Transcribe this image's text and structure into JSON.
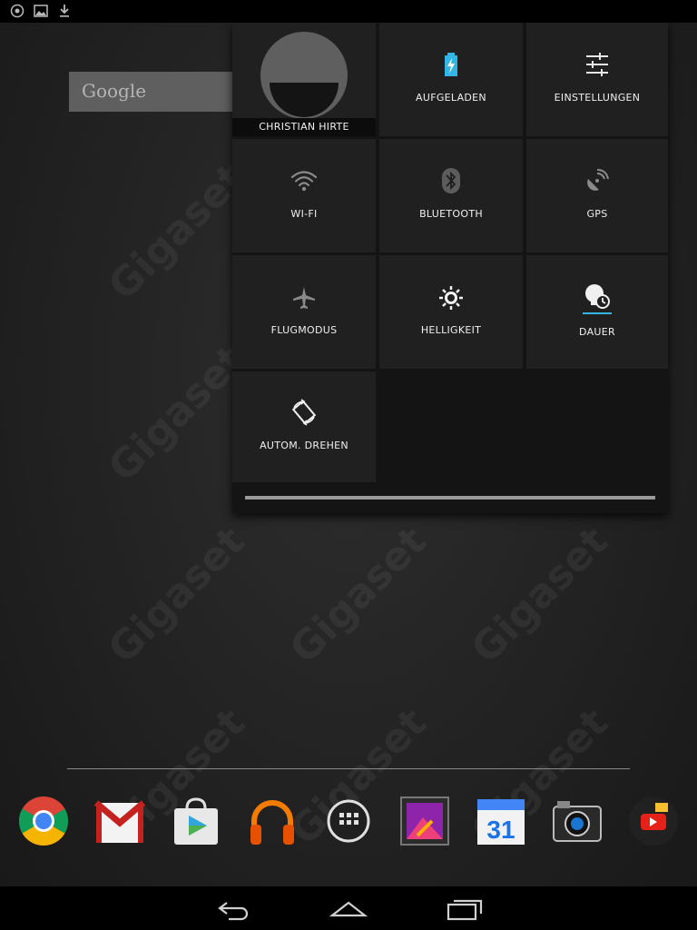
{
  "statusbar": {
    "icons": [
      "network-settings-icon",
      "gallery-icon",
      "download-icon"
    ]
  },
  "google_bar": {
    "logo_text": "Google"
  },
  "quick_settings": {
    "user": {
      "name": "CHRISTIAN HIRTE"
    },
    "tiles": [
      {
        "label": "AUFGELADEN",
        "icon": "battery-charging-icon"
      },
      {
        "label": "EINSTELLUNGEN",
        "icon": "settings-sliders-icon"
      },
      {
        "label": "WI-FI",
        "icon": "wifi-icon"
      },
      {
        "label": "BLUETOOTH",
        "icon": "bluetooth-icon"
      },
      {
        "label": "GPS",
        "icon": "gps-icon"
      },
      {
        "label": "FLUGMODUS",
        "icon": "airplane-icon"
      },
      {
        "label": "HELLIGKEIT",
        "icon": "brightness-icon"
      },
      {
        "label": "DAUER",
        "icon": "screen-timeout-icon"
      },
      {
        "label": "AUTOM. DREHEN",
        "icon": "auto-rotate-icon"
      }
    ]
  },
  "wallpaper": {
    "watermark": "Gigaset"
  },
  "dock": {
    "apps": [
      "chrome-icon",
      "gmail-icon",
      "play-store-icon",
      "play-music-icon",
      "app-drawer-icon",
      "gallery-app-icon",
      "calendar-icon",
      "camera-icon",
      "youtube-icon"
    ],
    "calendar_day": "31"
  },
  "navbar": {
    "buttons": [
      "back-icon",
      "home-icon",
      "recents-icon"
    ]
  },
  "colors": {
    "accent": "#33b5e5",
    "panel": "#141414",
    "tile": "#202020"
  }
}
